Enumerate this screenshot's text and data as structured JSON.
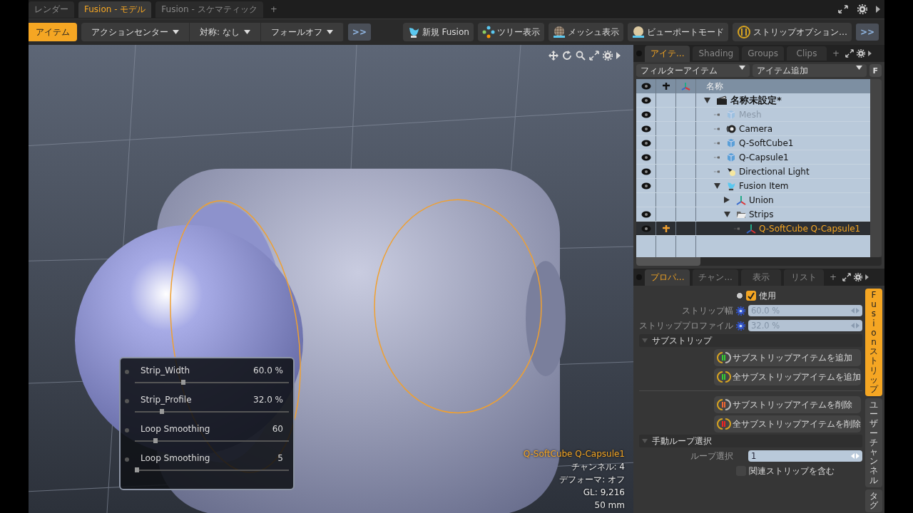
{
  "layout_tabs": [
    {
      "label": "レンダー",
      "selected": false
    },
    {
      "label": "Fusion - モデル",
      "selected": true
    },
    {
      "label": "Fusion - スケマティック",
      "selected": false
    }
  ],
  "add_tab": "+",
  "toolbar": {
    "mode_button": {
      "label": "アイテム",
      "active": true
    },
    "dropdowns": [
      "アクションセンター",
      "対称: なし",
      "フォールオフ"
    ],
    "more_left": ">>",
    "tools": [
      {
        "label": "新規 Fusion",
        "kind": "fusion"
      },
      {
        "label": "ツリー表示",
        "kind": "tree"
      },
      {
        "label": "メッシュ表示",
        "kind": "mesh"
      },
      {
        "label": "ビューポートモード",
        "kind": "sphere"
      },
      {
        "label": "ストリップオプション…",
        "kind": "strip"
      }
    ],
    "more_right": ">>"
  },
  "viewport": {
    "sliders": [
      {
        "name": "Strip_Width",
        "value": "60.0 %",
        "level": 0.3
      },
      {
        "name": "Strip_Profile",
        "value": "32.0 %",
        "level": 0.16
      },
      {
        "name": "Loop Smoothing",
        "value": "60",
        "level": 0.12
      },
      {
        "name": "Loop Smoothing",
        "value": "5",
        "level": 0
      }
    ],
    "selection": "Q-SoftCube Q-Capsule1",
    "info": [
      "チャンネル: 4",
      "デフォーマ: オフ",
      "GL: 9,216",
      "50 mm"
    ]
  },
  "outliner": {
    "tabs": [
      {
        "label": "アイテ...",
        "selected": true
      },
      {
        "label": "Shading",
        "selected": false
      },
      {
        "label": "Groups",
        "selected": false
      },
      {
        "label": "Clips",
        "selected": false
      }
    ],
    "add_tab": "+",
    "filter": "フィルターアイテム",
    "add_item": "アイテム追加",
    "filter_button": "F",
    "name_column": "名称",
    "items": [
      {
        "label": "名称未設定*",
        "kind": "scene",
        "visible": true,
        "selected": false,
        "dimmed": false,
        "expanded": true,
        "children": [
          {
            "label": "Mesh",
            "kind": "mesh",
            "visible": true,
            "selected": false,
            "dimmed": true
          },
          {
            "label": "Camera",
            "kind": "camera",
            "visible": true,
            "selected": false,
            "dimmed": false
          },
          {
            "label": "Q-SoftCube1",
            "kind": "mesh",
            "visible": true,
            "selected": false,
            "dimmed": false
          },
          {
            "label": "Q-Capsule1",
            "kind": "mesh",
            "visible": true,
            "selected": false,
            "dimmed": false
          },
          {
            "label": "Directional Light",
            "kind": "light",
            "visible": true,
            "selected": false,
            "dimmed": false
          },
          {
            "label": "Fusion Item",
            "kind": "fusion",
            "visible": true,
            "selected": false,
            "dimmed": false,
            "expanded": true,
            "children": [
              {
                "label": "Union",
                "kind": "axes",
                "visible": false,
                "selected": false,
                "dimmed": false,
                "expanded": false
              },
              {
                "label": "Strips",
                "kind": "folder",
                "visible": true,
                "selected": false,
                "dimmed": false,
                "expanded": true,
                "children": [
                  {
                    "label": "Q-SoftCube Q-Capsule1",
                    "kind": "axes",
                    "visible": true,
                    "selected": true,
                    "dimmed": false
                  }
                ]
              }
            ]
          }
        ]
      }
    ]
  },
  "properties": {
    "tabs": [
      {
        "label": "プロパ...",
        "selected": true
      },
      {
        "label": "チャン...",
        "selected": false
      },
      {
        "label": "表示",
        "selected": false
      },
      {
        "label": "リスト",
        "selected": false
      }
    ],
    "add_tab": "+",
    "enable": {
      "label": "使用",
      "checked": true,
      "radio_selected": false
    },
    "fields": [
      {
        "label": "ストリップ幅",
        "value": "60.0 %",
        "disabled": true
      },
      {
        "label": "ストリッププロファイル",
        "value": "32.0 %",
        "disabled": true
      }
    ],
    "section_substrip": "サブストリップ",
    "button_groups": [
      [
        {
          "label": "サブストリップアイテムを追加",
          "kind": "add"
        },
        {
          "label": "全サブストリップアイテムを追加",
          "kind": "add-all"
        }
      ],
      [
        {
          "label": "サブストリップアイテムを削除",
          "kind": "remove"
        },
        {
          "label": "全サブストリップアイテムを削除",
          "kind": "remove-all"
        }
      ]
    ],
    "section_loop": "手動ループ選択",
    "loop_field": {
      "label": "ループ選択",
      "value": "1",
      "disabled": false
    },
    "related": {
      "label": "関連ストリップを含む",
      "checked": false
    },
    "side_tabs": [
      {
        "label": "Fusion ストリップ",
        "selected": true
      },
      {
        "label": "ユーザーチャンネル",
        "selected": false
      },
      {
        "label": "タグ",
        "selected": false
      }
    ]
  }
}
